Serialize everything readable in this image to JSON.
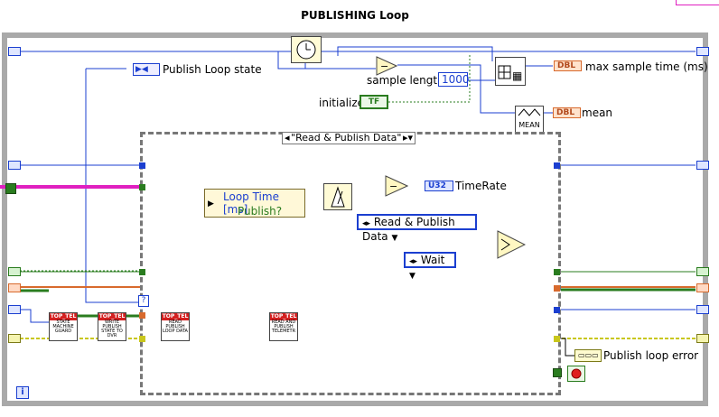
{
  "loop": {
    "title": "PUBLISHING Loop"
  },
  "controls": {
    "publish_loop_state": "Publish Loop state",
    "sample_length_label": "sample length",
    "sample_length_value": "1000",
    "initialize": "initialize",
    "max_sample_time": "max sample time (ms)",
    "mean": "mean",
    "mean_block": "MEAN",
    "tf": "TF",
    "dbl": "DBL",
    "u32": "U32",
    "time_rate": "TimeRate",
    "publish_loop_error": "Publish loop error"
  },
  "case": {
    "selector": "\"Read & Publish Data\"",
    "ring_enum": "Read & Publish Data",
    "ring_wait": "Wait",
    "cluster_loop_time": "Loop Time [ms]",
    "cluster_publish": "Publish?"
  },
  "subvis": {
    "state_guard_hd": "TOP_TEL",
    "state_guard": "STATE MACHINE GUARD",
    "write_state_hd": "TOP_TEL",
    "write_state": "WRITE PUBLISH STATE TO DVR",
    "read_loop_hd": "TOP_TEL",
    "read_loop": "READ PUBLISH LOOP DATA",
    "read_publish_hd": "TOP_TEL",
    "read_publish": "READ AND PUBLISH TELEMETR"
  },
  "misc": {
    "info_glyph": "i",
    "q_glyph": "?"
  },
  "colors": {
    "blue_wire": "#1b3fd0",
    "green_wire": "#2a7c1f",
    "orange_wire": "#d86a2d",
    "pink_wire": "#e020c0",
    "yellow_wire": "#c9c71c"
  }
}
